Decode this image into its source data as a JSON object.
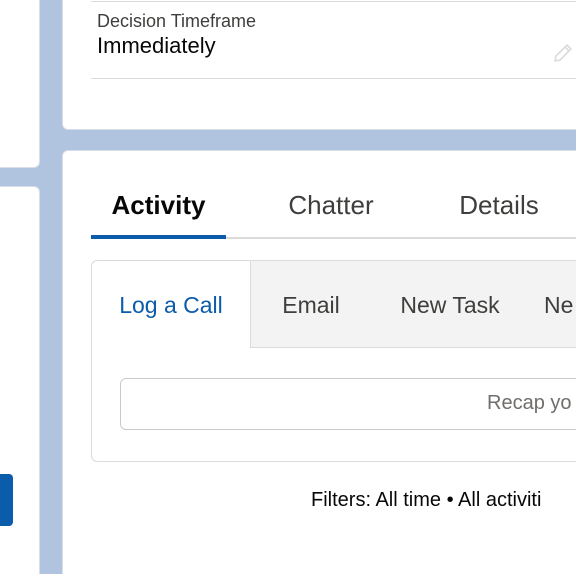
{
  "field": {
    "label": "Decision Timeframe",
    "value": "Immediately",
    "edit_icon": "pencil-icon"
  },
  "tabs": [
    {
      "label": "Activity",
      "active": true
    },
    {
      "label": "Chatter",
      "active": false
    },
    {
      "label": "Details",
      "active": false
    }
  ],
  "composer": {
    "tabs": [
      {
        "label": "Log a Call",
        "active": true
      },
      {
        "label": "Email",
        "active": false
      },
      {
        "label": "New Task",
        "active": false
      },
      {
        "label": "Ne",
        "active": false
      }
    ],
    "placeholder": "Recap yo"
  },
  "filters": {
    "text": "Filters: All time • All activiti"
  },
  "colors": {
    "background": "#b0c4df",
    "brand": "#0b5cab",
    "tab_bar_bg": "#f3f3f3"
  }
}
